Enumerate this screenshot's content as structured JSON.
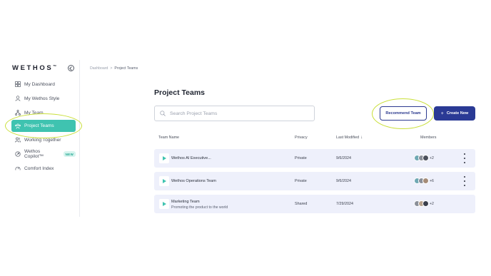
{
  "brand": {
    "logo": "WETHOS",
    "trademark": "TM"
  },
  "sidebar": {
    "items": [
      {
        "label": "My Dashboard",
        "icon": "dashboard-icon"
      },
      {
        "label": "My Wethos Style",
        "icon": "user-icon"
      },
      {
        "label": "My Team",
        "icon": "team-tree-icon"
      },
      {
        "label": "Project Teams",
        "icon": "project-teams-icon",
        "active": true
      },
      {
        "label": "Working Together",
        "icon": "users-icon"
      },
      {
        "label": "Wethos Copilot™",
        "icon": "copilot-icon",
        "badge": "NEW"
      },
      {
        "label": "Comfort Index",
        "icon": "gauge-icon"
      }
    ]
  },
  "breadcrumb": {
    "root": "Dashboard",
    "separator": ">",
    "current": "Project Teams"
  },
  "main": {
    "title": "Project Teams",
    "search": {
      "placeholder": "Search Project Teams",
      "value": ""
    },
    "recommend_label": "Recommend Team",
    "create_label": "Create New"
  },
  "table": {
    "headers": {
      "name": "Team Name",
      "privacy": "Privacy",
      "modified": "Last Modified",
      "members": "Members"
    },
    "sort_indicator": "↓",
    "rows": [
      {
        "name": "Wethos AI Executive...",
        "subtitle": "",
        "privacy": "Private",
        "modified": "9/6/2024",
        "members_more": "+2"
      },
      {
        "name": "Wethos Operations Team",
        "subtitle": "",
        "privacy": "Private",
        "modified": "9/6/2024",
        "members_more": "+6"
      },
      {
        "name": "Marketing Team",
        "subtitle": "Promoting the product to the world",
        "privacy": "Shared",
        "modified": "7/29/2024",
        "members_more": "+2"
      }
    ]
  },
  "colors": {
    "accent_teal": "#3fc3b0",
    "primary_navy": "#2a3a95",
    "highlight_annotation": "#c9df38",
    "row_background": "#eef0fb"
  }
}
